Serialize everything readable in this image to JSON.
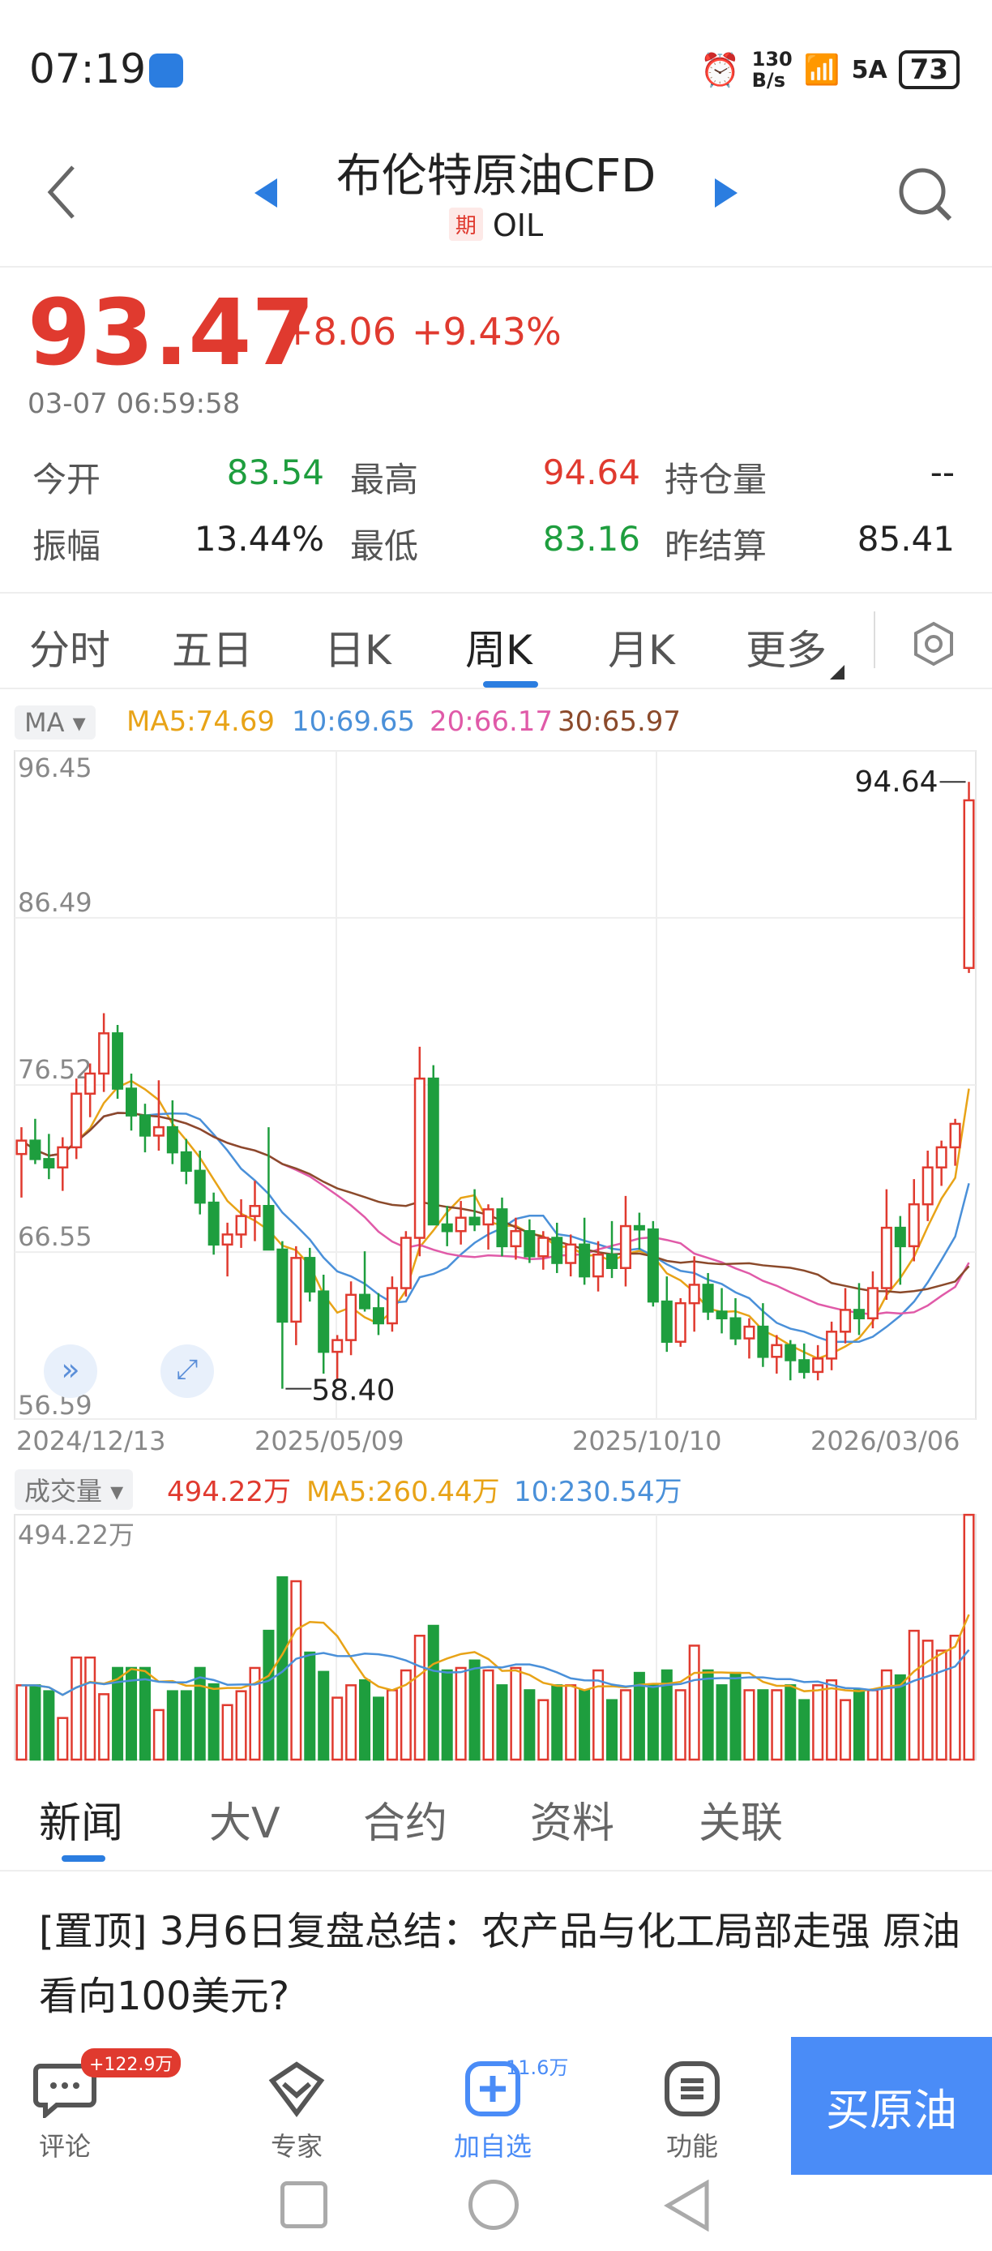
{
  "status_bar": {
    "time": "07:19",
    "net_speed_top": "130",
    "net_speed_bottom": "B/s",
    "signal": "5A",
    "battery": "73"
  },
  "header": {
    "title": "布伦特原油CFD",
    "tag": "期",
    "code": "OIL"
  },
  "quote": {
    "price": "93.47",
    "change": "+8.06",
    "change_pct": "+9.43%",
    "timestamp": "03-07 06:59:58",
    "stats": [
      {
        "label": "今开",
        "value": "83.54",
        "color": "#1e9e3e"
      },
      {
        "label": "最高",
        "value": "94.64",
        "color": "#e03a2f"
      },
      {
        "label": "持仓量",
        "value": "--",
        "color": "#222222"
      },
      {
        "label": "振幅",
        "value": "13.44%",
        "color": "#222222"
      },
      {
        "label": "最低",
        "value": "83.16",
        "color": "#1e9e3e"
      },
      {
        "label": "昨结算",
        "value": "85.41",
        "color": "#222222"
      }
    ]
  },
  "period_tabs": [
    "分时",
    "五日",
    "日K",
    "周K",
    "月K",
    "更多"
  ],
  "active_tab": "周K",
  "ma_legend": {
    "selector": "MA ▾",
    "ma5": "MA5:74.69",
    "ma10": "10:69.65",
    "ma20": "20:66.17",
    "ma30": "30:65.97"
  },
  "vol_legend": {
    "selector": "成交量 ▾",
    "vol": "494.22万",
    "ma5": "MA5:260.44万",
    "ma10": "10:230.54万"
  },
  "colors": {
    "up": "#e03a2f",
    "down": "#1e9e3e",
    "ma5": "#e8a317",
    "ma10": "#4a90d9",
    "ma20": "#e05aa8",
    "ma30": "#8b4a2b",
    "accent": "#2b7de0"
  },
  "chart_data": {
    "type": "candlestick",
    "title": "布伦特原油CFD 周K",
    "y_ticks": [
      "96.45",
      "86.49",
      "76.52",
      "66.55",
      "56.59"
    ],
    "ylim": [
      56.59,
      96.45
    ],
    "x_ticks": [
      "2024/12/13",
      "2025/05/09",
      "2025/10/10",
      "2026/03/06"
    ],
    "high_marker": "94.64",
    "low_marker": "58.40",
    "volume_max_label": "494.22万",
    "volume_ylim": [
      0,
      494.22
    ],
    "candles": [
      [
        72.4,
        74.0,
        69.8,
        73.2
      ],
      [
        73.2,
        74.5,
        71.8,
        72.1
      ],
      [
        72.1,
        73.6,
        70.9,
        71.6
      ],
      [
        71.6,
        73.4,
        70.2,
        72.8
      ],
      [
        72.8,
        76.9,
        72.1,
        76.0
      ],
      [
        76.0,
        77.8,
        74.6,
        77.2
      ],
      [
        77.2,
        80.8,
        76.1,
        79.6
      ],
      [
        79.6,
        80.1,
        75.7,
        76.3
      ],
      [
        76.3,
        77.2,
        73.8,
        74.7
      ],
      [
        74.7,
        75.4,
        72.5,
        73.5
      ],
      [
        73.5,
        76.8,
        72.6,
        74.0
      ],
      [
        74.0,
        75.6,
        71.8,
        72.5
      ],
      [
        72.5,
        73.3,
        70.6,
        71.4
      ],
      [
        71.4,
        72.6,
        68.8,
        69.5
      ],
      [
        69.5,
        70.1,
        66.4,
        67.0
      ],
      [
        67.0,
        68.3,
        65.1,
        67.6
      ],
      [
        67.6,
        69.7,
        66.8,
        68.7
      ],
      [
        68.7,
        70.8,
        67.2,
        69.3
      ],
      [
        69.3,
        74.0,
        68.5,
        66.7
      ],
      [
        66.7,
        67.2,
        58.4,
        62.4
      ],
      [
        62.4,
        66.9,
        61.0,
        66.2
      ],
      [
        66.2,
        66.8,
        63.6,
        64.2
      ],
      [
        64.2,
        65.2,
        59.3,
        60.6
      ],
      [
        60.6,
        61.6,
        58.9,
        61.3
      ],
      [
        61.3,
        64.8,
        60.4,
        64.0
      ],
      [
        64.0,
        66.6,
        63.0,
        63.2
      ],
      [
        63.2,
        64.1,
        61.6,
        62.3
      ],
      [
        62.3,
        65.1,
        61.8,
        64.4
      ],
      [
        64.4,
        67.8,
        63.9,
        67.4
      ],
      [
        67.4,
        78.8,
        66.3,
        76.9
      ],
      [
        76.9,
        77.7,
        69.0,
        68.2
      ],
      [
        68.2,
        69.3,
        66.9,
        67.8
      ],
      [
        67.8,
        69.6,
        67.0,
        68.6
      ],
      [
        68.6,
        70.3,
        67.8,
        68.2
      ],
      [
        68.2,
        69.4,
        66.7,
        69.1
      ],
      [
        69.1,
        69.8,
        66.3,
        66.9
      ],
      [
        66.9,
        68.6,
        66.1,
        67.8
      ],
      [
        67.8,
        68.5,
        65.9,
        66.3
      ],
      [
        66.3,
        67.8,
        65.5,
        67.4
      ],
      [
        67.4,
        68.3,
        65.3,
        65.9
      ],
      [
        65.9,
        67.6,
        65.1,
        67.0
      ],
      [
        67.0,
        68.6,
        64.6,
        65.1
      ],
      [
        65.1,
        67.2,
        64.2,
        66.4
      ],
      [
        66.4,
        68.4,
        65.0,
        65.6
      ],
      [
        65.6,
        69.9,
        64.5,
        68.1
      ],
      [
        68.1,
        68.9,
        66.7,
        67.9
      ],
      [
        67.9,
        68.4,
        63.3,
        63.6
      ],
      [
        63.6,
        65.1,
        60.6,
        61.2
      ],
      [
        61.2,
        63.8,
        60.9,
        63.5
      ],
      [
        63.5,
        66.3,
        61.8,
        64.6
      ],
      [
        64.6,
        65.3,
        62.5,
        63.0
      ],
      [
        63.0,
        64.4,
        61.7,
        62.6
      ],
      [
        62.6,
        63.8,
        61.0,
        61.4
      ],
      [
        61.4,
        62.6,
        60.2,
        62.1
      ],
      [
        62.1,
        63.5,
        59.7,
        60.3
      ],
      [
        60.3,
        61.6,
        59.3,
        61.0
      ],
      [
        61.0,
        61.3,
        58.9,
        60.1
      ],
      [
        60.1,
        61.1,
        59.0,
        59.4
      ],
      [
        59.4,
        61.0,
        58.9,
        60.2
      ],
      [
        60.2,
        62.4,
        59.5,
        61.8
      ],
      [
        61.8,
        64.4,
        61.1,
        63.1
      ],
      [
        63.1,
        64.7,
        61.6,
        62.6
      ],
      [
        62.6,
        65.4,
        62.0,
        64.4
      ],
      [
        64.4,
        70.3,
        63.7,
        68.0
      ],
      [
        68.0,
        68.7,
        64.6,
        66.9
      ],
      [
        66.9,
        70.9,
        66.0,
        69.4
      ],
      [
        69.4,
        72.6,
        68.4,
        71.6
      ],
      [
        71.6,
        73.2,
        70.5,
        72.8
      ],
      [
        72.8,
        74.5,
        71.7,
        74.2
      ],
      [
        83.5,
        94.6,
        83.2,
        93.5
      ]
    ],
    "volumes": [
      150,
      150,
      138,
      84,
      206,
      206,
      132,
      185,
      185,
      185,
      100,
      138,
      138,
      185,
      152,
      110,
      138,
      185,
      260,
      368,
      360,
      216,
      177,
      125,
      150,
      160,
      125,
      140,
      180,
      250,
      270,
      180,
      185,
      200,
      180,
      150,
      185,
      140,
      120,
      150,
      150,
      140,
      180,
      120,
      140,
      175,
      150,
      180,
      140,
      230,
      180,
      150,
      175,
      140,
      140,
      140,
      150,
      120,
      150,
      160,
      120,
      140,
      140,
      180,
      170,
      260,
      240,
      220,
      250,
      494
    ]
  },
  "news_tabs": [
    "新闻",
    "大V",
    "合约",
    "资料",
    "关联"
  ],
  "news_item": "[置顶] 3月6日复盘总结：农产品与化工局部走强 原油看向100美元?",
  "bottom_bar": {
    "comment_label": "评论",
    "comment_badge": "+122.9万",
    "expert_label": "专家",
    "watch_label": "加自选",
    "watch_badge": "11.6万",
    "func_label": "功能",
    "buy_label": "买原油"
  }
}
